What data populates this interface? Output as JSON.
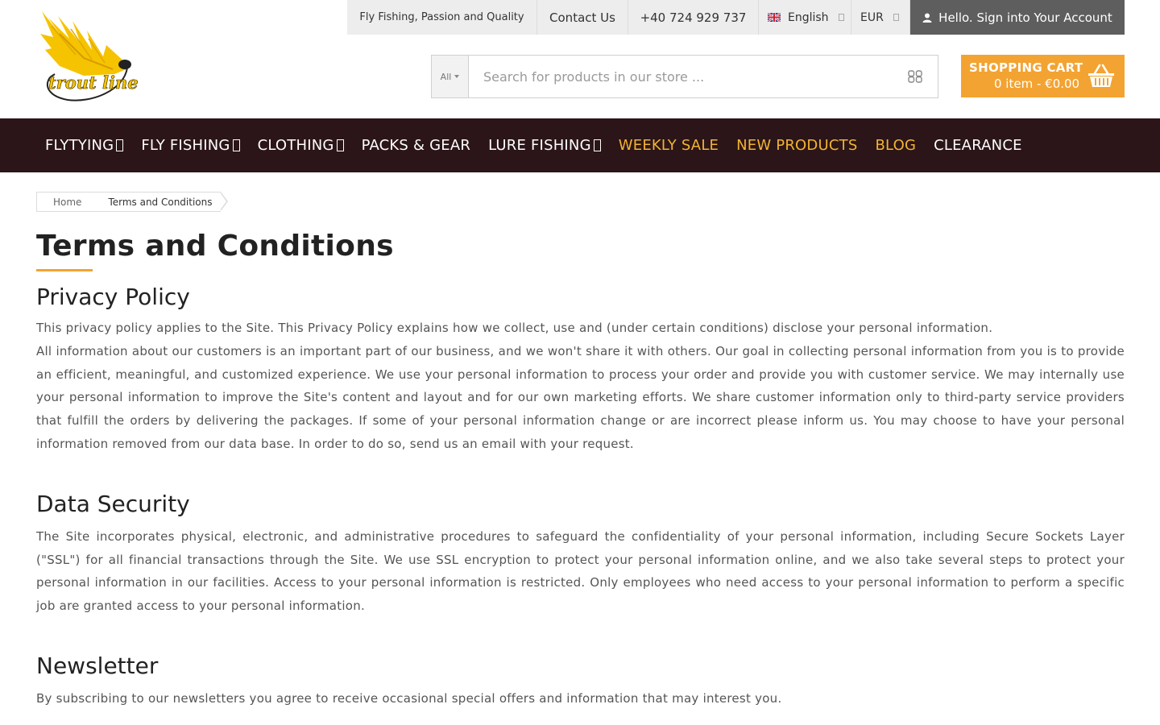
{
  "logo": {
    "text": "trout line"
  },
  "topbar": {
    "tagline": "Fly Fishing, Passion and Quality",
    "contact": "Contact Us",
    "phone": "+40 724 929 737",
    "language": "English",
    "currency": "EUR",
    "account": "Hello. Sign into Your Account"
  },
  "search": {
    "category": "All",
    "placeholder": "Search for products in our store ..."
  },
  "cart": {
    "title": "SHOPPING CART",
    "summary": "0 item - €0.00"
  },
  "nav": {
    "items": [
      {
        "label": "FLYTYING"
      },
      {
        "label": "FLY FISHING"
      },
      {
        "label": "CLOTHING"
      },
      {
        "label": "PACKS & GEAR"
      },
      {
        "label": "LURE FISHING"
      },
      {
        "label": "WEEKLY SALE"
      },
      {
        "label": "NEW PRODUCTS"
      },
      {
        "label": "BLOG"
      },
      {
        "label": "CLEARANCE"
      }
    ]
  },
  "breadcrumb": {
    "home": "Home",
    "current": "Terms and Conditions"
  },
  "page": {
    "title": "Terms and Conditions",
    "sections": [
      {
        "heading": "Privacy Policy",
        "paragraphs": [
          "This privacy policy applies to the Site. This Privacy Policy explains how we collect, use and (under certain conditions) disclose your personal information.",
          "All information about our customers is an important part of our business, and we won't share it with others. Our goal in collecting personal information from you is to provide an efficient, meaningful, and customized experience. We use your personal information to process your order and provide you with customer service. We may internally use your personal information to improve the Site's content and layout and for our own marketing efforts. We share customer information only to third-party service providers that fulfill the orders by delivering the packages. If some of your personal information change or are incorrect please inform us. You may choose to have your personal information removed from our data base. In order to do so, send us an email with your request."
        ]
      },
      {
        "heading": "Data Security",
        "paragraphs": [
          "The Site incorporates physical, electronic, and administrative procedures to safeguard the confidentiality of your personal information, including Secure Sockets Layer (\"SSL\") for all financial transactions through the Site. We use SSL encryption to protect your personal information online, and we also take several steps to protect your personal information in our facilities. Access to your personal information is restricted. Only employees who need access to your personal information to perform a specific job are granted access to your personal information."
        ]
      },
      {
        "heading": "Newsletter",
        "paragraphs": [
          "By subscribing to our newsletters you agree to receive occasional special offers and information that may interest you."
        ]
      }
    ]
  },
  "colors": {
    "accent": "#f3a331",
    "nav_bg": "#2b1518",
    "nav_highlight": "#f3b332",
    "account_bg": "#5e5e5e"
  },
  "icons": {
    "flag": "uk-flag-icon",
    "account": "user-icon",
    "search": "search-icon",
    "cart": "basket-icon"
  }
}
